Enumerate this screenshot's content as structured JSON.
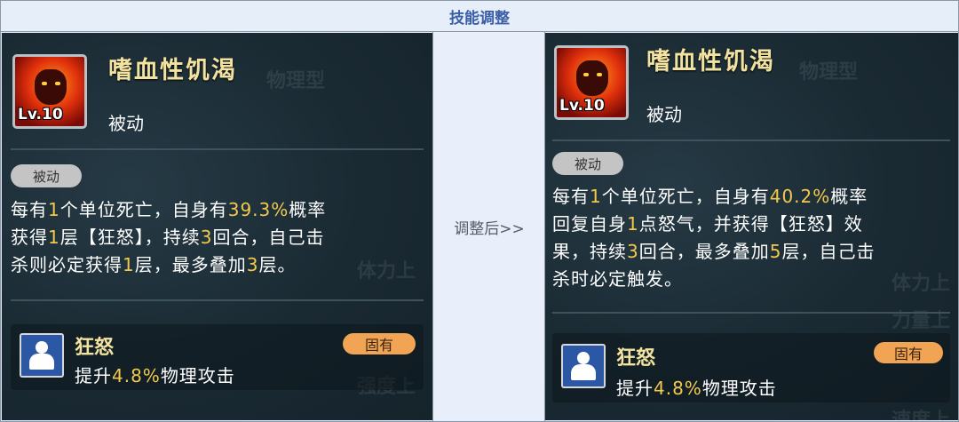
{
  "header": {
    "title": "技能调整"
  },
  "center": {
    "label": "调整后>>"
  },
  "background_ghost_text": [
    "物理型",
    "体力上",
    "力量上",
    "强度上",
    "速度上"
  ],
  "before": {
    "skill_level": "Lv.10",
    "skill_name": "嗜血性饥渴",
    "skill_type": "被动",
    "badge": "被动",
    "description_lines": [
      [
        {
          "t": "每有"
        },
        {
          "t": "1",
          "hl": true
        },
        {
          "t": "个单位死亡，自身有"
        },
        {
          "t": "39.3%",
          "hl": true
        },
        {
          "t": "概率"
        }
      ],
      [
        {
          "t": "获得"
        },
        {
          "t": "1",
          "hl": true
        },
        {
          "t": "层【狂怒】，持续"
        },
        {
          "t": "3",
          "hl": true
        },
        {
          "t": "回合，自己击"
        }
      ],
      [
        {
          "t": "杀则必定获得"
        },
        {
          "t": "1",
          "hl": true
        },
        {
          "t": "层，最多叠加"
        },
        {
          "t": "3",
          "hl": true
        },
        {
          "t": "层。"
        }
      ]
    ],
    "trait": {
      "name": "狂怒",
      "tag": "固有",
      "desc_prefix": "提升",
      "desc_value": "4.8%",
      "desc_suffix": "物理攻击"
    }
  },
  "after": {
    "skill_level": "Lv.10",
    "skill_name": "嗜血性饥渴",
    "skill_type": "被动",
    "badge": "被动",
    "description_lines": [
      [
        {
          "t": "每有"
        },
        {
          "t": "1",
          "hl": true
        },
        {
          "t": "个单位死亡，自身有"
        },
        {
          "t": "40.2%",
          "hl": true
        },
        {
          "t": "概率"
        }
      ],
      [
        {
          "t": "回复自身"
        },
        {
          "t": "1",
          "hl": true
        },
        {
          "t": "点怒气，并获得【狂怒】效"
        }
      ],
      [
        {
          "t": "果，持续"
        },
        {
          "t": "3",
          "hl": true
        },
        {
          "t": "回合，最多叠加"
        },
        {
          "t": "5",
          "hl": true
        },
        {
          "t": "层，自己击"
        }
      ],
      [
        {
          "t": "杀时必定触发。"
        }
      ]
    ],
    "trait": {
      "name": "狂怒",
      "tag": "固有",
      "desc_prefix": "提升",
      "desc_value": "4.8%",
      "desc_suffix": "物理攻击"
    }
  },
  "colors": {
    "highlight": "#f2c94c",
    "title_blue": "#3a5ea8",
    "tag_orange": "#f2a455"
  }
}
